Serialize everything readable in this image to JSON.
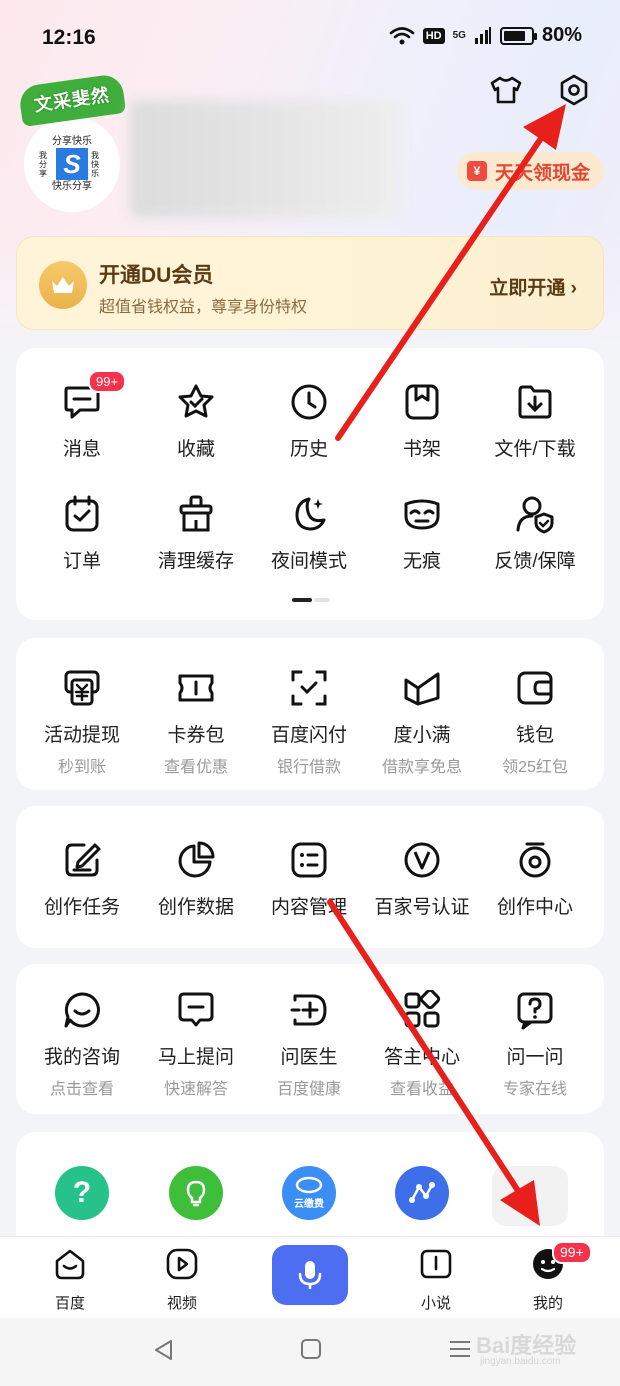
{
  "status_bar": {
    "time": "12:16",
    "hd": "HD",
    "network": "5G",
    "battery_pct": "80%",
    "battery_level": 0.8
  },
  "profile": {
    "avatar_tag": "文采斐然",
    "avatar_top": "分享快乐",
    "avatar_left": "我分享",
    "avatar_right": "我快乐",
    "avatar_bottom": "快乐分享",
    "avatar_letter": "S",
    "cash_label": "天天领现金"
  },
  "vip": {
    "title": "开通DU会员",
    "subtitle": "超值省钱权益，尊享身份特权",
    "cta": "立即开通 ›"
  },
  "shortcuts": {
    "row1": [
      {
        "label": "消息",
        "icon": "message-icon",
        "badge": "99+"
      },
      {
        "label": "收藏",
        "icon": "star-icon"
      },
      {
        "label": "历史",
        "icon": "clock-icon"
      },
      {
        "label": "书架",
        "icon": "bookshelf-icon"
      },
      {
        "label": "文件/下载",
        "icon": "download-folder-icon"
      }
    ],
    "row2": [
      {
        "label": "订单",
        "icon": "order-icon"
      },
      {
        "label": "清理缓存",
        "icon": "clean-icon"
      },
      {
        "label": "夜间模式",
        "icon": "moon-icon"
      },
      {
        "label": "无痕",
        "icon": "mask-icon"
      },
      {
        "label": "反馈/保障",
        "icon": "feedback-shield-icon"
      }
    ]
  },
  "finance": [
    {
      "label": "活动提现",
      "sub": "秒到账",
      "icon": "withdraw-icon"
    },
    {
      "label": "卡券包",
      "sub": "查看优惠",
      "icon": "ticket-icon"
    },
    {
      "label": "百度闪付",
      "sub": "银行借款",
      "icon": "scan-pay-icon"
    },
    {
      "label": "度小满",
      "sub": "借款享免息",
      "icon": "duxiaoman-icon"
    },
    {
      "label": "钱包",
      "sub": "领25红包",
      "icon": "wallet-icon"
    }
  ],
  "creator": [
    {
      "label": "创作任务",
      "icon": "edit-task-icon"
    },
    {
      "label": "创作数据",
      "icon": "pie-chart-icon"
    },
    {
      "label": "内容管理",
      "icon": "list-icon"
    },
    {
      "label": "百家号认证",
      "icon": "v-badge-icon"
    },
    {
      "label": "创作中心",
      "icon": "creator-center-icon"
    }
  ],
  "health": [
    {
      "label": "我的咨询",
      "sub": "点击查看",
      "icon": "consult-icon"
    },
    {
      "label": "马上提问",
      "sub": "快速解答",
      "icon": "ask-icon"
    },
    {
      "label": "问医生",
      "sub": "百度健康",
      "icon": "doctor-icon"
    },
    {
      "label": "答主中心",
      "sub": "查看收益",
      "icon": "apps-icon"
    },
    {
      "label": "问一问",
      "sub": "专家在线",
      "icon": "question-icon"
    }
  ],
  "apps": [
    {
      "icon": "qa-app-icon",
      "color": "#27c28a",
      "glyph": "?"
    },
    {
      "icon": "bulb-app-icon",
      "color": "#3fbe3a",
      "glyph": "✦"
    },
    {
      "icon": "cloud-app-icon",
      "color": "#3a8ef5",
      "glyph": "云缴费"
    },
    {
      "icon": "graph-app-icon",
      "color": "#3e6fe8",
      "glyph": "⋰"
    },
    {
      "icon": "partial-app-icon",
      "color": "#f0f0f0",
      "glyph": ""
    }
  ],
  "tabbar": {
    "home": "百度",
    "video": "视频",
    "novel": "小说",
    "me": "我的",
    "me_badge": "99+"
  },
  "watermark": {
    "text": "Bai度经验",
    "sub": "jingyan.baidu.com"
  },
  "colors": {
    "accent": "#4e6ef2",
    "badge": "#f5314b",
    "vip_text": "#5b3a12",
    "arrow": "#e8201c"
  }
}
